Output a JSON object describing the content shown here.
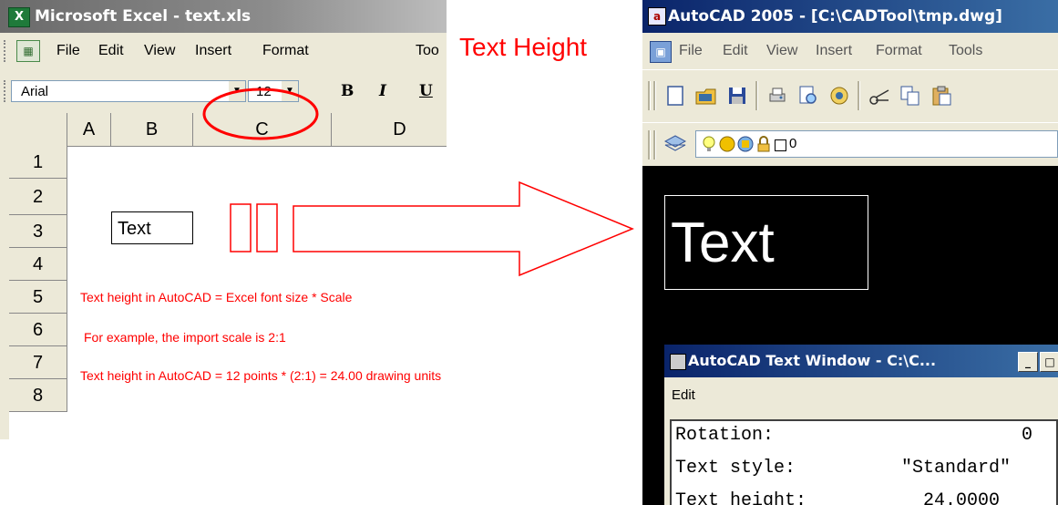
{
  "excel": {
    "title": "Microsoft Excel - text.xls",
    "menu": [
      "File",
      "Edit",
      "View",
      "Insert",
      "Format",
      "Too"
    ],
    "font_name": "Arial",
    "font_size": "12",
    "format_buttons": [
      "B",
      "I",
      "U"
    ],
    "columns": [
      "A",
      "B",
      "C",
      "D"
    ],
    "rows": [
      "1",
      "2",
      "3",
      "4",
      "5",
      "6",
      "7",
      "8"
    ],
    "cell_b2": "Text",
    "notes": [
      "Text height in AutoCAD = Excel font size * Scale",
      "For example, the import scale is 2:1",
      "Text height in AutoCAD = 12 points * (2:1) = 24.00 drawing units"
    ]
  },
  "annotation": {
    "label": "Text Height",
    "color": "#ff0000"
  },
  "autocad": {
    "title": "AutoCAD 2005 - [C:\\CADTool\\tmp.dwg]",
    "menu": [
      "File",
      "Edit",
      "View",
      "Insert",
      "Format",
      "Tools"
    ],
    "layer_name": "0",
    "drawing_text": "Text",
    "text_window": {
      "title": "AutoCAD Text Window - C:\\C...",
      "menu": "Edit",
      "lines": [
        {
          "label": "Rotation:",
          "value": "0"
        },
        {
          "label": "Text style:",
          "value": "\"Standard\""
        },
        {
          "label": "Text height:",
          "value": "24.0000"
        }
      ]
    }
  },
  "icons": [
    "excel-app-icon",
    "excel-doc-icon",
    "autocad-app-icon",
    "autocad-doc-icon",
    "new-icon",
    "open-icon",
    "save-icon",
    "plot-icon",
    "preview-icon",
    "publish-icon",
    "cut-icon",
    "copy-icon",
    "paste-icon",
    "layers-icon",
    "bulb-icon",
    "sun-icon",
    "lock-icon",
    "color-swatch-icon",
    "minimize-icon",
    "maximize-icon"
  ]
}
